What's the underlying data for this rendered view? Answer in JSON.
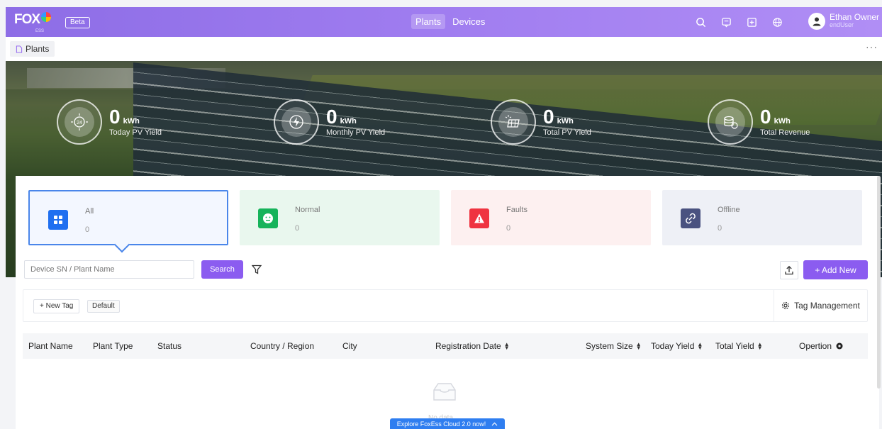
{
  "header": {
    "logo_text": "FOX",
    "logo_sub": "ESS",
    "beta_badge": "Beta",
    "tabs": [
      {
        "label": "Plants",
        "active": true
      },
      {
        "label": "Devices",
        "active": false
      }
    ],
    "icons": [
      "search-icon",
      "message-icon",
      "add-square-icon",
      "globe-icon"
    ],
    "user": {
      "name": "Ethan Owner",
      "role": "endUser"
    }
  },
  "breadcrumb": {
    "tab_label": "Plants",
    "more": "···"
  },
  "stats": [
    {
      "value": "0",
      "unit": "kWh",
      "label": "Today PV Yield",
      "icon": "sun-24-icon"
    },
    {
      "value": "0",
      "unit": "kWh",
      "label": "Monthly  PV Yield",
      "icon": "lightning-icon"
    },
    {
      "value": "0",
      "unit": "kWh",
      "label": "Total PV Yield",
      "icon": "solar-panel-icon"
    },
    {
      "value": "0",
      "unit": "kWh",
      "label": "Total Revenue",
      "icon": "coins-icon"
    }
  ],
  "status_tiles": [
    {
      "label": "All",
      "count": "0",
      "color": "#1f6ff0"
    },
    {
      "label": "Normal",
      "count": "0",
      "color": "#16b35a"
    },
    {
      "label": "Faults",
      "count": "0",
      "color": "#ef3340"
    },
    {
      "label": "Offline",
      "count": "0",
      "color": "#4a5280"
    }
  ],
  "search": {
    "placeholder": "Device SN / Plant Name",
    "button": "Search"
  },
  "actions": {
    "add_new": "+ Add New"
  },
  "tags": {
    "new_tag": "+  New Tag",
    "default": "Default",
    "management": "Tag Management"
  },
  "table": {
    "columns": [
      "Plant Name",
      "Plant Type",
      "Status",
      "Country / Region",
      "City",
      "Registration Date",
      "System Size",
      "Today Yield",
      "Total Yield",
      "Opertion"
    ],
    "rows": [],
    "empty_text": "No data"
  },
  "banner": {
    "text": "Explore FoxEss Cloud 2.0 now!"
  },
  "colors": {
    "primary": "#8b5cf0",
    "header_start": "#8d6de6",
    "header_end": "#b08ef5",
    "selected_border": "#4a86ea"
  }
}
